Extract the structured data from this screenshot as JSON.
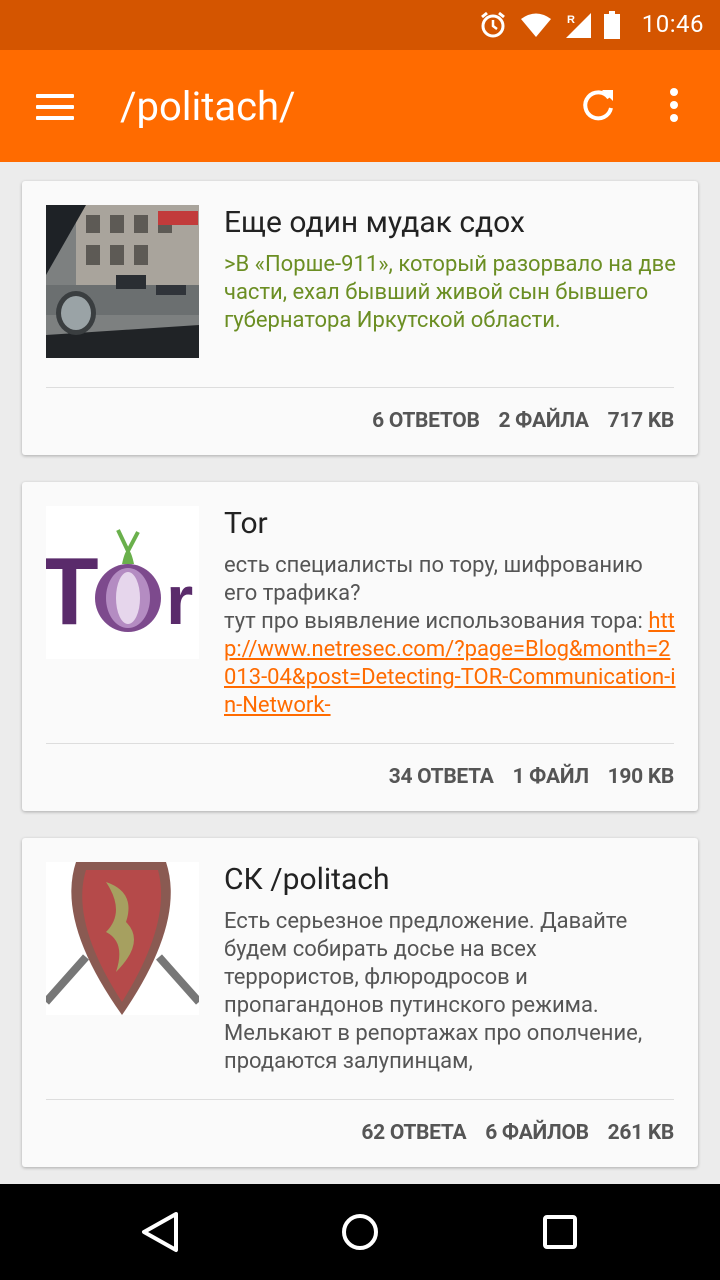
{
  "status_bar": {
    "time": "10:46",
    "icons": [
      "alarm-icon",
      "wifi-icon",
      "signal-roaming-icon",
      "battery-icon"
    ]
  },
  "app_bar": {
    "title": "/politach/",
    "icons": [
      "menu-icon",
      "refresh-icon",
      "more-vert-icon"
    ],
    "color": "#ff6b00"
  },
  "threads": [
    {
      "title": "Еще один мудак сдох",
      "snippet": ">В «Порше-911», который разорвало на две части, ехал бывший живой сын бывшего губернатора Иркутской области.",
      "snippet_color": "#6b8e23",
      "replies": "6 ОТВЕТОВ",
      "files": "2 ФАЙЛА",
      "size": "717 KB"
    },
    {
      "title": "Tor",
      "snippet_text": "есть специалисты по тору, шифрованию его трафика?\nтут про выявление использования тора: ",
      "snippet_link": "http://www.netresec.com/?page=Blog&month=2013-04&post=Detecting-TOR-Communication-in-Network-",
      "replies": "34 ОТВЕТА",
      "files": "1 ФАЙЛ",
      "size": "190 KB"
    },
    {
      "title": "СК /politach",
      "snippet": "Есть серьезное предложение. Давайте будем собирать досье на всех террористов, флюродросов и пропагандонов путинского режима. Мелькают в репортажах про ополчение, продаются залупинцам,",
      "replies": "62 ОТВЕТА",
      "files": "6 ФАЙЛОВ",
      "size": "261 KB"
    }
  ],
  "nav_bar": {
    "icons": [
      "back-icon",
      "home-icon",
      "recents-icon"
    ]
  }
}
